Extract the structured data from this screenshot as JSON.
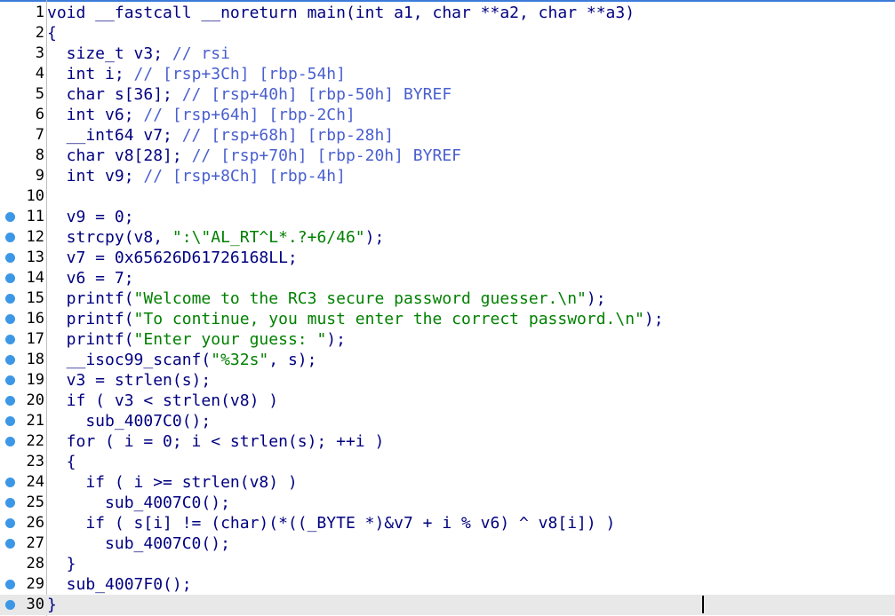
{
  "editor": {
    "lines": [
      {
        "num": "1",
        "bp": false,
        "code": "void __fastcall __noreturn main(int a1, char **a2, char **a3)"
      },
      {
        "num": "2",
        "bp": false,
        "code": "{"
      },
      {
        "num": "3",
        "bp": false,
        "code": "  size_t v3; // rsi"
      },
      {
        "num": "4",
        "bp": false,
        "code": "  int i; // [rsp+3Ch] [rbp-54h]"
      },
      {
        "num": "5",
        "bp": false,
        "code": "  char s[36]; // [rsp+40h] [rbp-50h] BYREF"
      },
      {
        "num": "6",
        "bp": false,
        "code": "  int v6; // [rsp+64h] [rbp-2Ch]"
      },
      {
        "num": "7",
        "bp": false,
        "code": "  __int64 v7; // [rsp+68h] [rbp-28h]"
      },
      {
        "num": "8",
        "bp": false,
        "code": "  char v8[28]; // [rsp+70h] [rbp-20h] BYREF"
      },
      {
        "num": "9",
        "bp": false,
        "code": "  int v9; // [rsp+8Ch] [rbp-4h]"
      },
      {
        "num": "10",
        "bp": false,
        "code": ""
      },
      {
        "num": "11",
        "bp": true,
        "code": "  v9 = 0;"
      },
      {
        "num": "12",
        "bp": true,
        "code": "  strcpy(v8, \":\\\"AL_RT^L*.?+6/46\");"
      },
      {
        "num": "13",
        "bp": true,
        "code": "  v7 = 0x65626D61726168LL;"
      },
      {
        "num": "14",
        "bp": true,
        "code": "  v6 = 7;"
      },
      {
        "num": "15",
        "bp": true,
        "code": "  printf(\"Welcome to the RC3 secure password guesser.\\n\");"
      },
      {
        "num": "16",
        "bp": true,
        "code": "  printf(\"To continue, you must enter the correct password.\\n\");"
      },
      {
        "num": "17",
        "bp": true,
        "code": "  printf(\"Enter your guess: \");"
      },
      {
        "num": "18",
        "bp": true,
        "code": "  __isoc99_scanf(\"%32s\", s);"
      },
      {
        "num": "19",
        "bp": true,
        "code": "  v3 = strlen(s);"
      },
      {
        "num": "20",
        "bp": true,
        "code": "  if ( v3 < strlen(v8) )"
      },
      {
        "num": "21",
        "bp": true,
        "code": "    sub_4007C0();"
      },
      {
        "num": "22",
        "bp": true,
        "code": "  for ( i = 0; i < strlen(s); ++i )"
      },
      {
        "num": "23",
        "bp": false,
        "code": "  {"
      },
      {
        "num": "24",
        "bp": true,
        "code": "    if ( i >= strlen(v8) )"
      },
      {
        "num": "25",
        "bp": true,
        "code": "      sub_4007C0();"
      },
      {
        "num": "26",
        "bp": true,
        "code": "    if ( s[i] != (char)(*((_BYTE *)&v7 + i % v6) ^ v8[i]) )"
      },
      {
        "num": "27",
        "bp": true,
        "code": "      sub_4007C0();"
      },
      {
        "num": "28",
        "bp": false,
        "code": "  }"
      },
      {
        "num": "29",
        "bp": true,
        "code": "  sub_4007F0();"
      },
      {
        "num": "30",
        "bp": true,
        "code": "}"
      }
    ],
    "current_line": "30"
  },
  "colors": {
    "code": "#000080",
    "string": "#008000",
    "comment": "#4a5fcf",
    "breakpoint_dot": "#3c97e6",
    "current_line_bg": "#e8e8e8"
  }
}
